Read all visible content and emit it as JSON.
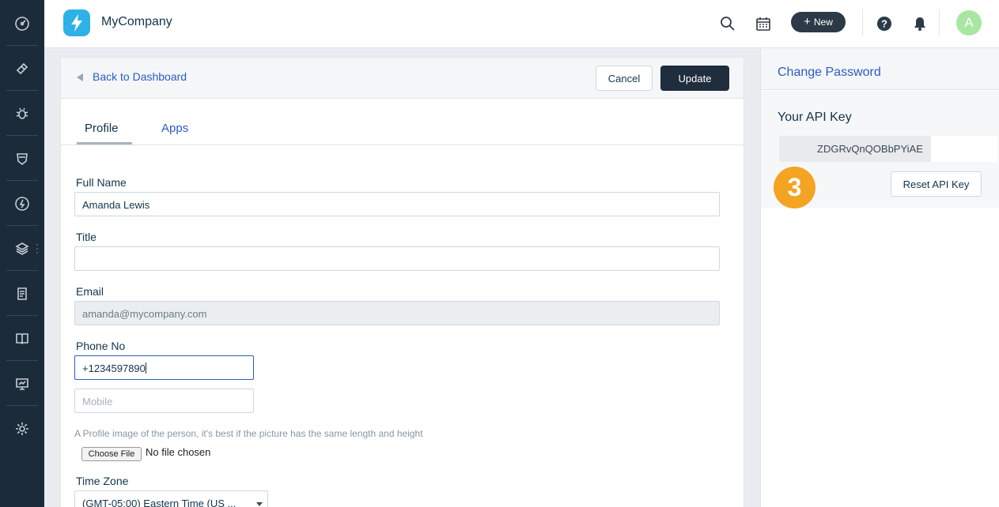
{
  "header": {
    "company_name": "MyCompany",
    "new_button_label": "New",
    "new_button_icon": "+",
    "avatar_initial": "A"
  },
  "leftnav": {
    "items": [
      "dashboard",
      "tickets",
      "problems",
      "changes",
      "releases",
      "assets",
      "solutions",
      "knowledge",
      "analytics",
      "settings"
    ]
  },
  "topbar": {
    "back_label": "Back to Dashboard",
    "cancel_label": "Cancel",
    "update_label": "Update"
  },
  "tabs": [
    {
      "label": "Profile",
      "active": true
    },
    {
      "label": "Apps",
      "active": false
    }
  ],
  "form": {
    "full_name_label": "Full Name",
    "full_name_value": "Amanda Lewis",
    "title_label": "Title",
    "title_value": "",
    "email_label": "Email",
    "email_value": "amanda@mycompany.com",
    "phone_label": "Phone No",
    "phone_value": "+1234597890",
    "mobile_placeholder": "Mobile",
    "profile_image_hint": "A Profile image of the person, it's best if the picture has the same length and height",
    "choose_file_label": "Choose File",
    "file_status": "No file chosen",
    "timezone_label": "Time Zone",
    "timezone_value": "(GMT-05:00) Eastern Time (US ..."
  },
  "right_panel": {
    "change_password_label": "Change Password",
    "api_key_title": "Your API Key",
    "api_key_value": "ZDGRvQnQOBbPYiAE",
    "reset_api_key_label": "Reset API Key",
    "step_badge": "3"
  },
  "colors": {
    "nav_bg": "#1c2b3a",
    "link": "#2c5cc5",
    "primary_button": "#1f2d3d",
    "logo": "#2db1e6",
    "avatar": "#a8e6a1",
    "step_badge": "#f4a423"
  }
}
